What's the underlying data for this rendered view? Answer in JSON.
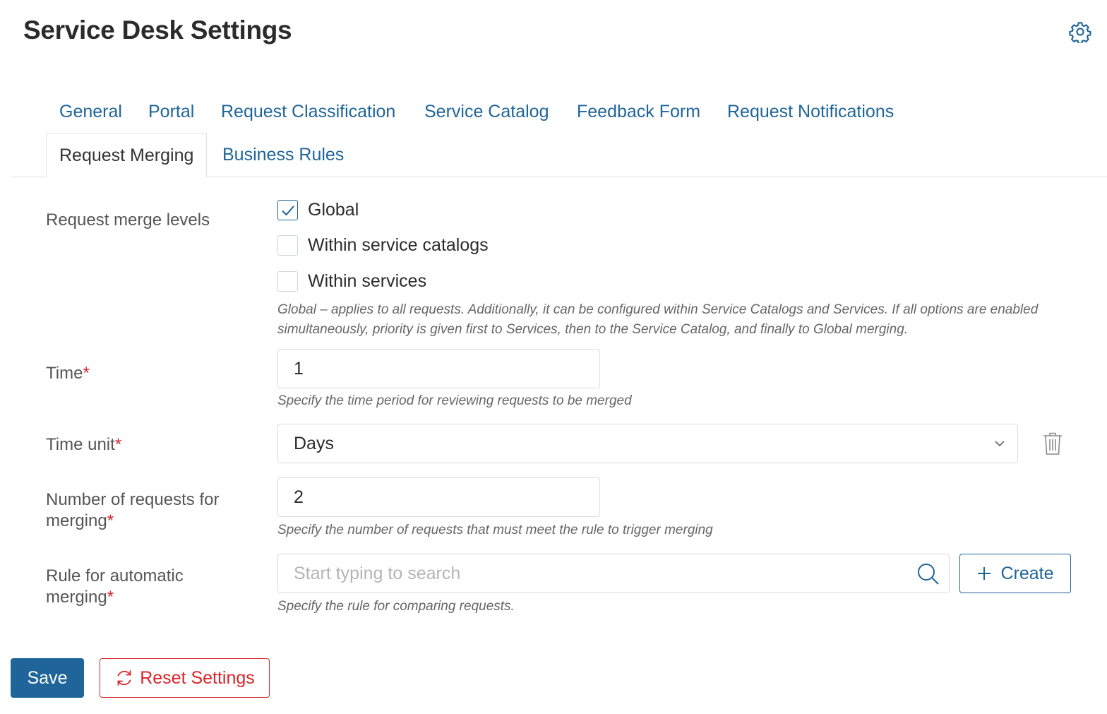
{
  "page": {
    "title": "Service Desk Settings"
  },
  "tabs": [
    {
      "label": "General"
    },
    {
      "label": "Portal"
    },
    {
      "label": "Request Classification"
    },
    {
      "label": "Service Catalog"
    },
    {
      "label": "Feedback Form"
    },
    {
      "label": "Request Notifications"
    },
    {
      "label": "Request Merging",
      "active": true
    },
    {
      "label": "Business Rules"
    }
  ],
  "form": {
    "merge_levels": {
      "label": "Request merge levels",
      "options": [
        {
          "label": "Global",
          "checked": true
        },
        {
          "label": "Within service catalogs",
          "checked": false
        },
        {
          "label": "Within services",
          "checked": false
        }
      ],
      "hint": "Global – applies to all requests. Additionally, it can be configured within Service Catalogs and Services. If all options are enabled simultaneously, priority is given first to Services, then to the Service Catalog, and finally to Global merging."
    },
    "time": {
      "label": "Time",
      "required": "*",
      "value": "1",
      "hint": "Specify the time period for reviewing requests to be merged"
    },
    "time_unit": {
      "label": "Time unit",
      "required": "*",
      "value": "Days"
    },
    "num_requests": {
      "label_line1": "Number of requests for",
      "label_line2": "merging",
      "required": "*",
      "value": "2",
      "hint": "Specify the number of requests that must meet the rule to trigger merging"
    },
    "rule": {
      "label_line1": "Rule for automatic",
      "label_line2": "merging",
      "required": "*",
      "placeholder": "Start typing to search",
      "create_label": "Create",
      "hint": "Specify the rule for comparing requests."
    }
  },
  "actions": {
    "save_label": "Save",
    "reset_label": "Reset Settings"
  },
  "colors": {
    "accent": "#1f6599",
    "danger": "#d9252a",
    "border": "#dcdcdc"
  },
  "icons": [
    "settings-gear-icon",
    "check-icon",
    "chevron-down-icon",
    "trash-icon",
    "search-icon",
    "plus-icon",
    "refresh-icon"
  ]
}
